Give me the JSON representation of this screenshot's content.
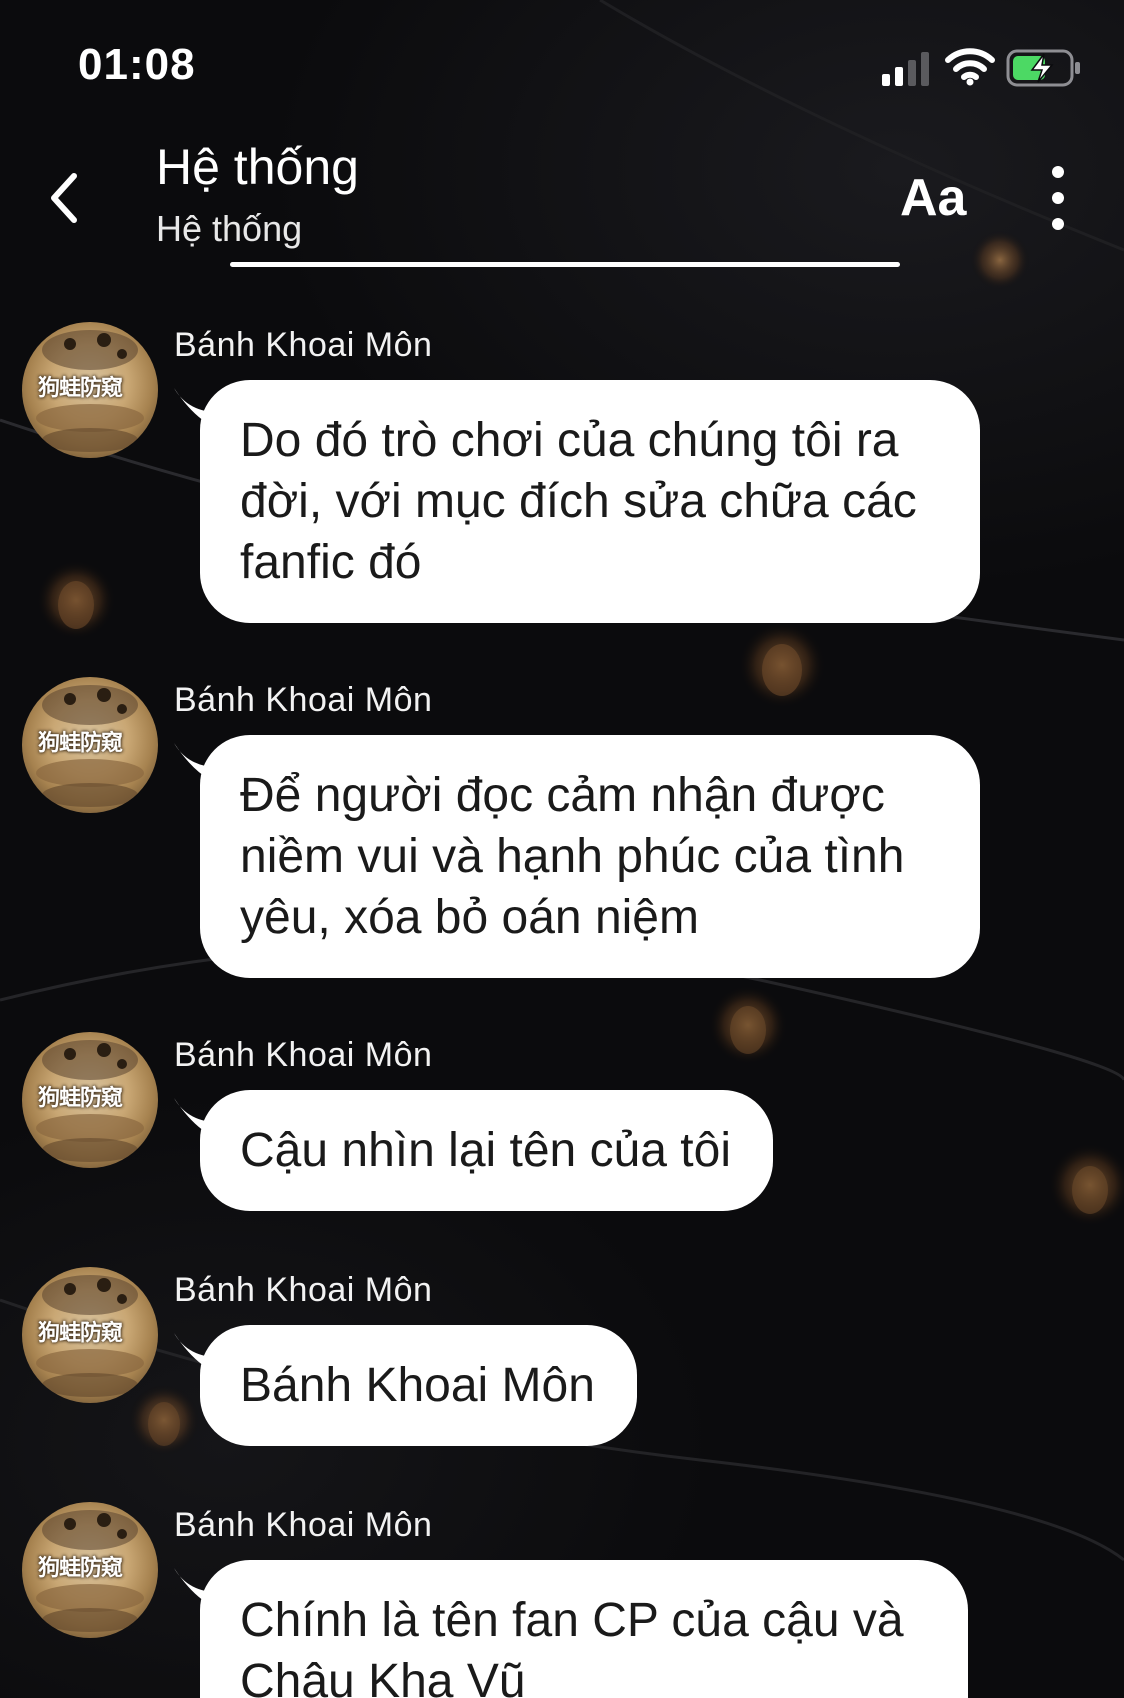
{
  "status_bar": {
    "time": "01:08"
  },
  "header": {
    "title": "Hệ thống",
    "subtitle": "Hệ thống",
    "font_button_label": "Aa"
  },
  "avatar": {
    "watermark_text": "狗蛙防窥"
  },
  "messages": [
    {
      "sender": "Bánh Khoai Môn",
      "text": "Do đó trò chơi của chúng tôi ra đời, với mục đích sửa chữa các fanfic đó"
    },
    {
      "sender": "Bánh Khoai Môn",
      "text": "Để người đọc cảm nhận được niềm vui và hạnh phúc của tình yêu, xóa bỏ oán niệm"
    },
    {
      "sender": "Bánh Khoai Môn",
      "text": "Cậu nhìn lại tên của tôi"
    },
    {
      "sender": "Bánh Khoai Môn",
      "text": "Bánh Khoai Môn"
    },
    {
      "sender": "Bánh Khoai Môn",
      "text": "Chính là tên fan CP của cậu và Châu Kha Vũ"
    }
  ],
  "colors": {
    "background": "#0b0b0d",
    "bubble": "#ffffff",
    "bubble_text": "#1a1a1a",
    "battery_fill": "#4cd964"
  },
  "icons": [
    "back-icon",
    "more-icon",
    "signal-icon",
    "wifi-icon",
    "battery-icon"
  ]
}
